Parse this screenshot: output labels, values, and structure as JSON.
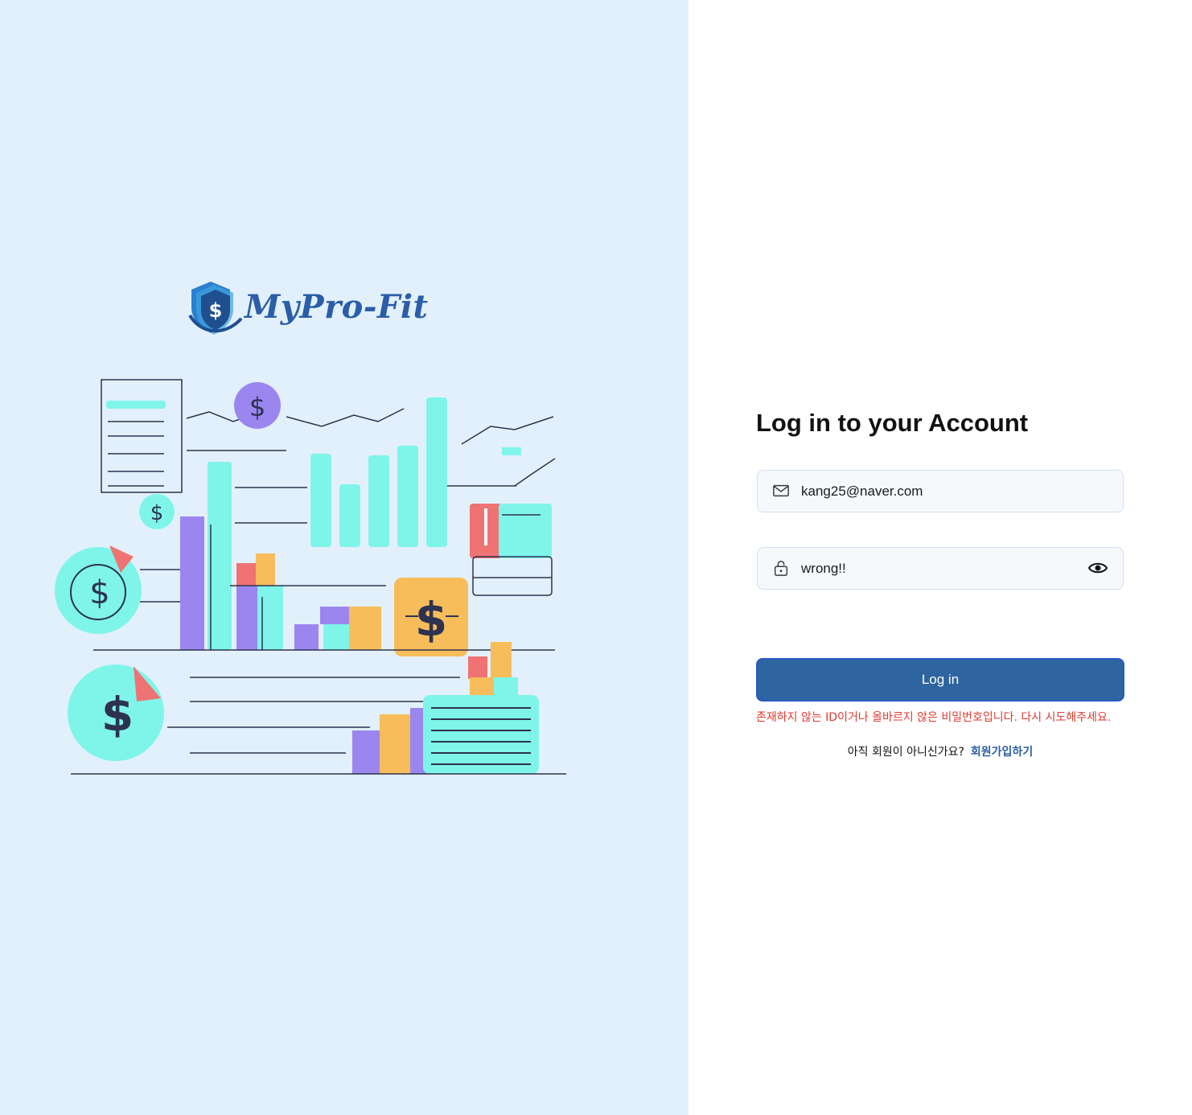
{
  "brand": {
    "name": "MyPro-Fit",
    "logo_icon": "shield-dollar-logo"
  },
  "illustration": {
    "type": "finance-charts-illustration",
    "dollar_symbol": "$"
  },
  "login": {
    "title": "Log in to your Account",
    "email": {
      "icon": "mail-icon",
      "value": "kang25@naver.com"
    },
    "password": {
      "icon": "lock-icon",
      "value": "wrong!!",
      "toggle_icon": "eye-icon"
    },
    "submit_label": "Log in",
    "error": "존재하지 않는 ID이거나 올바르지 않은 비밀번호입니다. 다시 시도해주세요.",
    "signup_prompt": "아직 회원이 아니신가요?",
    "signup_link": "회원가입하기"
  },
  "colors": {
    "left_panel": "#e2f0fb",
    "primary_button": "#2e65a0",
    "error": "#e03a2e",
    "link": "#2b5ea3"
  }
}
